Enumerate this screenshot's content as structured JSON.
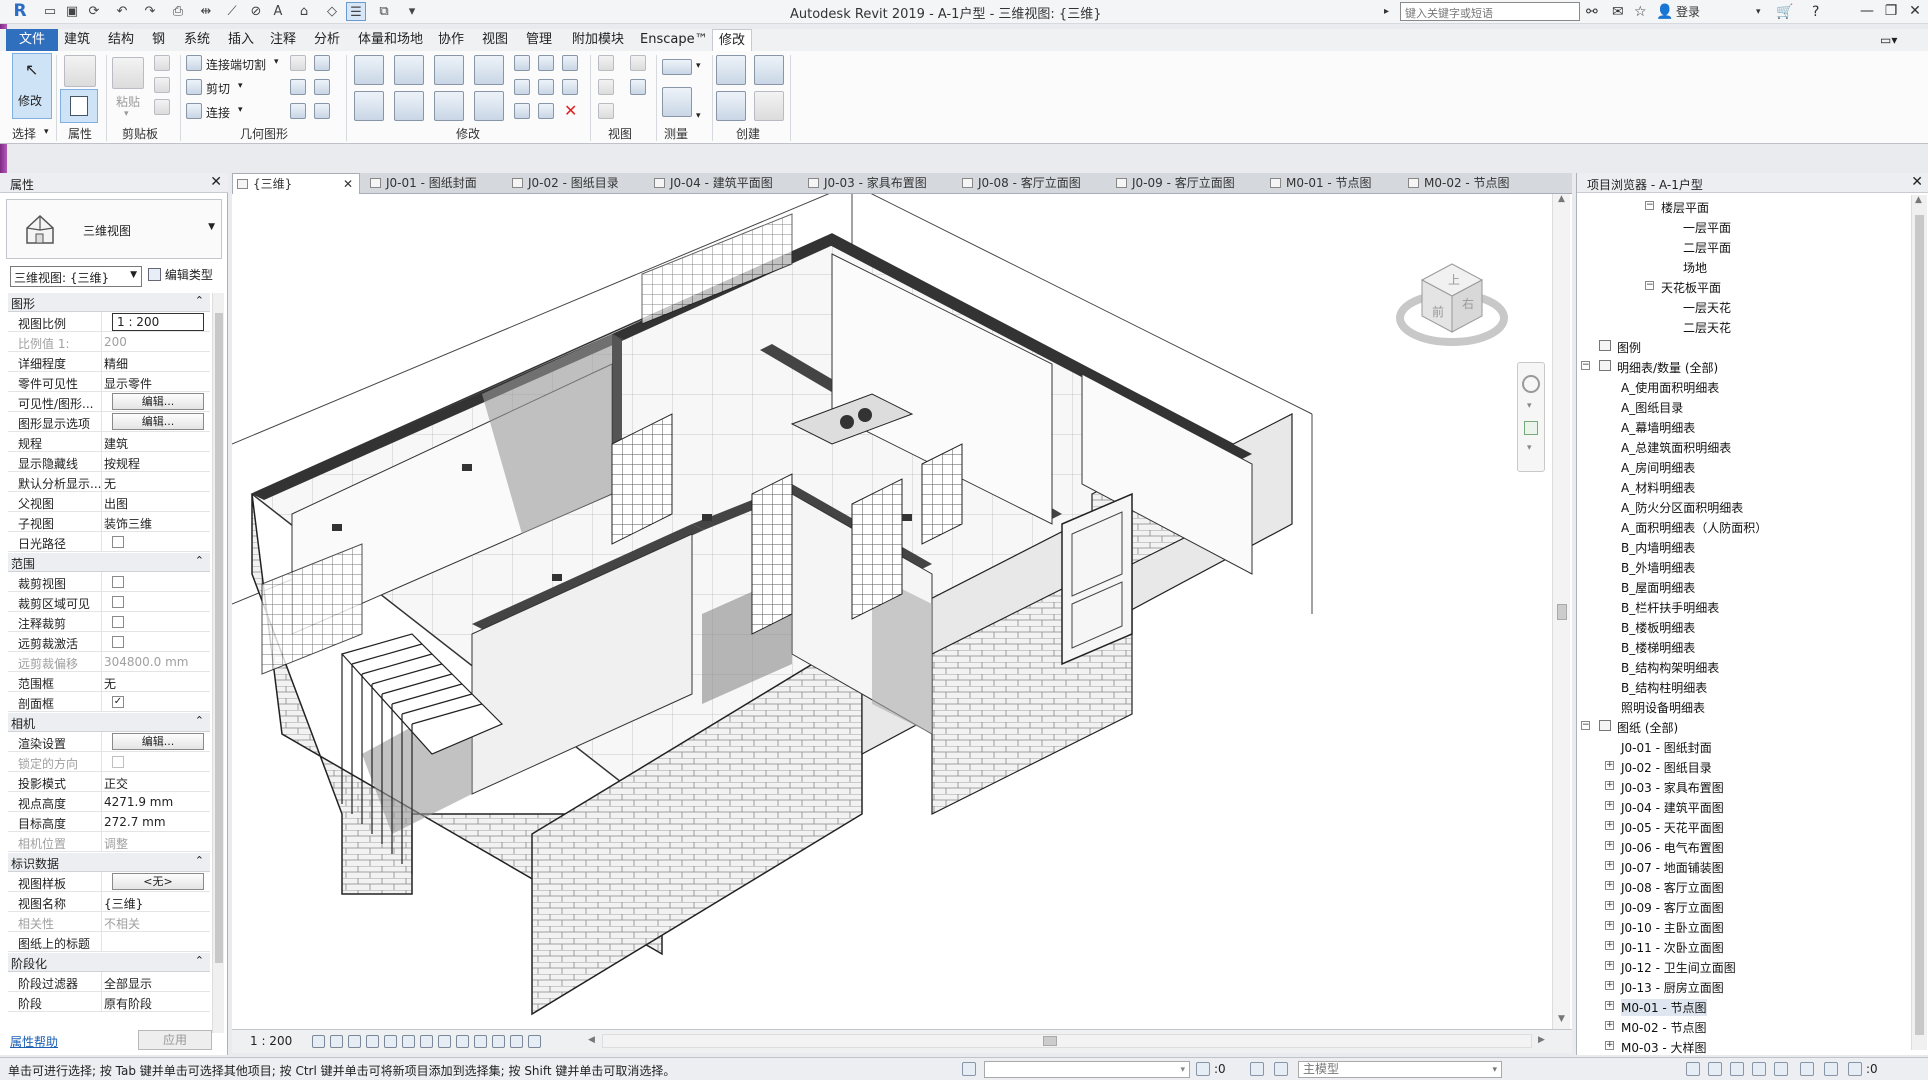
{
  "window": {
    "title": "Autodesk Revit 2019 - A-1户型 - 三维视图: {三维}",
    "search_placeholder": "键入关键字或短语",
    "login": "登录"
  },
  "menu": {
    "items": [
      "文件",
      "建筑",
      "结构",
      "钢",
      "系统",
      "插入",
      "注释",
      "分析",
      "体量和场地",
      "协作",
      "视图",
      "管理",
      "附加模块",
      "Enscape™",
      "修改"
    ]
  },
  "ribbon": {
    "modify_btn": "修改",
    "paste_btn": "粘贴",
    "join_cut": "连接端切割",
    "cut": "剪切",
    "join": "连接",
    "panels": {
      "select": "选择",
      "properties": "属性",
      "clipboard": "剪贴板",
      "geometry": "几何图形",
      "modify": "修改",
      "view": "视图",
      "measure": "测量",
      "create": "创建"
    }
  },
  "properties": {
    "title": "属性",
    "type_name": "三维视图",
    "view_dropdown": "三维视图: {三维}",
    "edit_type": "编辑类型",
    "help": "属性帮助",
    "apply": "应用",
    "groups": {
      "graphics": "图形",
      "extents": "范围",
      "camera": "相机",
      "identity": "标识数据",
      "phasing": "阶段化"
    },
    "rows": {
      "view_scale": [
        "视图比例",
        "1 : 200"
      ],
      "scale_value": [
        "比例值 1:",
        "200"
      ],
      "detail_level": [
        "详细程度",
        "精细"
      ],
      "parts_visibility": [
        "零件可见性",
        "显示零件"
      ],
      "visibility_graphics": [
        "可见性/图形...",
        "编辑..."
      ],
      "graphic_display": [
        "图形显示选项",
        "编辑..."
      ],
      "discipline": [
        "规程",
        "建筑"
      ],
      "show_hidden": [
        "显示隐藏线",
        "按规程"
      ],
      "default_analysis": [
        "默认分析显示...",
        "无"
      ],
      "parent_view": [
        "父视图",
        "出图"
      ],
      "sub_view": [
        "子视图",
        "装饰三维"
      ],
      "sun_path": [
        "日光路径",
        ""
      ],
      "crop_view": [
        "裁剪视图",
        ""
      ],
      "crop_visible": [
        "裁剪区域可见",
        ""
      ],
      "annotation_crop": [
        "注释裁剪",
        ""
      ],
      "far_clip_active": [
        "远剪裁激活",
        ""
      ],
      "far_clip_offset": [
        "远剪裁偏移",
        "304800.0 mm"
      ],
      "scope_box": [
        "范围框",
        "无"
      ],
      "section_box": [
        "剖面框",
        "✓"
      ],
      "render_settings": [
        "渲染设置",
        "编辑..."
      ],
      "locked_orientation": [
        "锁定的方向",
        ""
      ],
      "projection_mode": [
        "投影模式",
        "正交"
      ],
      "eye_elevation": [
        "视点高度",
        "4271.9 mm"
      ],
      "target_elevation": [
        "目标高度",
        "272.7 mm"
      ],
      "camera_position": [
        "相机位置",
        "调整"
      ],
      "view_template": [
        "视图样板",
        "<无>"
      ],
      "view_name": [
        "视图名称",
        "{三维}"
      ],
      "dependency": [
        "相关性",
        "不相关"
      ],
      "title_on_sheet": [
        "图纸上的标题",
        ""
      ],
      "phase_filter": [
        "阶段过滤器",
        "全部显示"
      ],
      "phase": [
        "阶段",
        "原有阶段"
      ]
    }
  },
  "view_tabs": [
    {
      "label": "{三维}",
      "active": true
    },
    {
      "label": "J0-01 - 图纸封面"
    },
    {
      "label": "J0-02 - 图纸目录"
    },
    {
      "label": "J0-04 - 建筑平面图"
    },
    {
      "label": "J0-03 - 家具布置图"
    },
    {
      "label": "J0-08 - 客厅立面图"
    },
    {
      "label": "J0-09 - 客厅立面图"
    },
    {
      "label": "M0-01 - 节点图"
    },
    {
      "label": "M0-02 - 节点图"
    }
  ],
  "viewcube": {
    "front": "前",
    "right": "右",
    "top": "上"
  },
  "view_control": {
    "scale": "1 : 200"
  },
  "browser": {
    "title": "项目浏览器 - A-1户型",
    "items": [
      {
        "label": "楼层平面",
        "level": 3,
        "toggle": "−"
      },
      {
        "label": "一层平面",
        "level": 4
      },
      {
        "label": "二层平面",
        "level": 4
      },
      {
        "label": "场地",
        "level": 4
      },
      {
        "label": "天花板平面",
        "level": 3,
        "toggle": "−"
      },
      {
        "label": "一层天花",
        "level": 4
      },
      {
        "label": "二层天花",
        "level": 4
      },
      {
        "label": "图例",
        "level": 1
      },
      {
        "label": "明细表/数量 (全部)",
        "level": 1,
        "toggle": "−"
      },
      {
        "label": "A_使用面积明细表",
        "level": 2
      },
      {
        "label": "A_图纸目录",
        "level": 2
      },
      {
        "label": "A_幕墙明细表",
        "level": 2
      },
      {
        "label": "A_总建筑面积明细表",
        "level": 2
      },
      {
        "label": "A_房间明细表",
        "level": 2
      },
      {
        "label": "A_材料明细表",
        "level": 2
      },
      {
        "label": "A_防火分区面积明细表",
        "level": 2
      },
      {
        "label": "A_面积明细表（人防面积）",
        "level": 2
      },
      {
        "label": "B_内墙明细表",
        "level": 2
      },
      {
        "label": "B_外墙明细表",
        "level": 2
      },
      {
        "label": "B_屋面明细表",
        "level": 2
      },
      {
        "label": "B_栏杆扶手明细表",
        "level": 2
      },
      {
        "label": "B_楼板明细表",
        "level": 2
      },
      {
        "label": "B_楼梯明细表",
        "level": 2
      },
      {
        "label": "B_结构构架明细表",
        "level": 2
      },
      {
        "label": "B_结构柱明细表",
        "level": 2
      },
      {
        "label": "照明设备明细表",
        "level": 2
      },
      {
        "label": "图纸 (全部)",
        "level": 1,
        "toggle": "−"
      },
      {
        "label": "J0-01 - 图纸封面",
        "level": 2
      },
      {
        "label": "J0-02 - 图纸目录",
        "level": 2,
        "toggle": "+"
      },
      {
        "label": "J0-03 - 家具布置图",
        "level": 2,
        "toggle": "+"
      },
      {
        "label": "J0-04 - 建筑平面图",
        "level": 2,
        "toggle": "+"
      },
      {
        "label": "J0-05 - 天花平面图",
        "level": 2,
        "toggle": "+"
      },
      {
        "label": "J0-06 - 电气布置图",
        "level": 2,
        "toggle": "+"
      },
      {
        "label": "J0-07 - 地面铺装图",
        "level": 2,
        "toggle": "+"
      },
      {
        "label": "J0-08 - 客厅立面图",
        "level": 2,
        "toggle": "+"
      },
      {
        "label": "J0-09 - 客厅立面图",
        "level": 2,
        "toggle": "+"
      },
      {
        "label": "J0-10 - 主卧立面图",
        "level": 2,
        "toggle": "+"
      },
      {
        "label": "J0-11 - 次卧立面图",
        "level": 2,
        "toggle": "+"
      },
      {
        "label": "J0-12 - 卫生间立面图",
        "level": 2,
        "toggle": "+"
      },
      {
        "label": "J0-13 - 厨房立面图",
        "level": 2,
        "toggle": "+"
      },
      {
        "label": "M0-01 - 节点图",
        "level": 2,
        "toggle": "+",
        "selected": true
      },
      {
        "label": "M0-02 - 节点图",
        "level": 2,
        "toggle": "+"
      },
      {
        "label": "M0-03 - 大样图",
        "level": 2,
        "toggle": "+"
      }
    ]
  },
  "status": {
    "message": "单击可进行选择; 按 Tab 键并单击可选择其他项目; 按 Ctrl 键并单击可将新项目添加到选择集; 按 Shift 键并单击可取消选择。",
    "workset_count": ":0",
    "model": "主模型",
    "filter_count": ":0"
  }
}
